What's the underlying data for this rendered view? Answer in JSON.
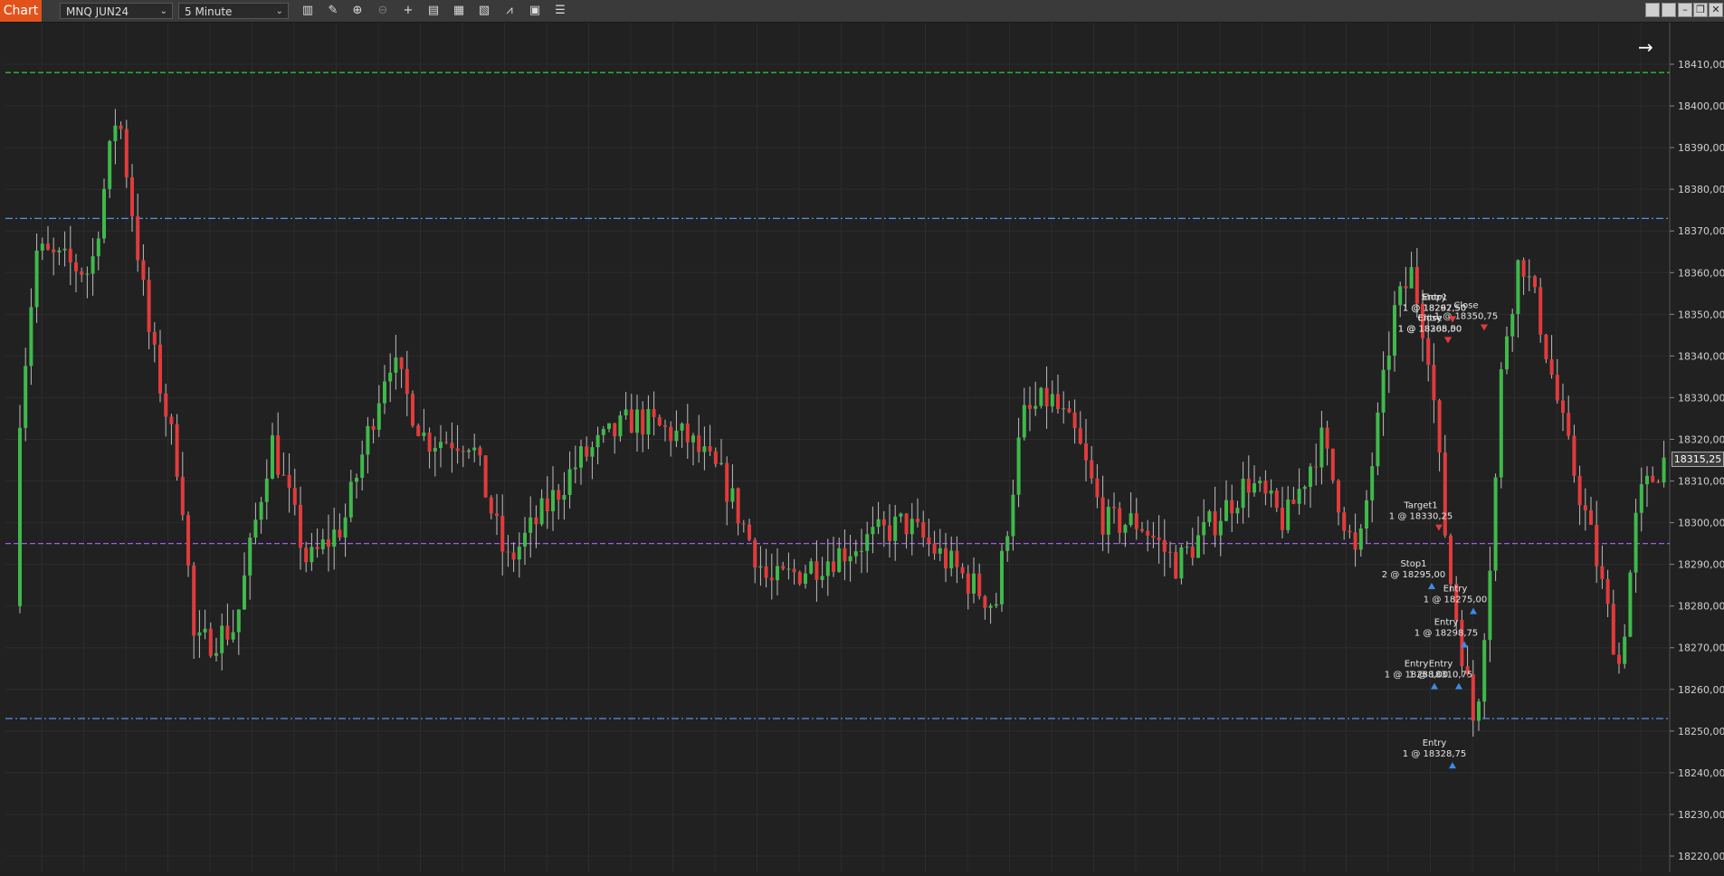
{
  "toolbar": {
    "tab_label": "Chart",
    "instrument": "MNQ JUN24",
    "interval": "5 Minute",
    "tools": [
      "bar-type-icon",
      "pencil-icon",
      "zoom-in-icon",
      "zoom-out-icon",
      "crosshair-icon",
      "properties-icon",
      "templates-icon",
      "indicators-icon",
      "strategies-icon",
      "data-box-icon",
      "list-icon"
    ]
  },
  "axis": {
    "ticks": [
      "18410,00",
      "18400,00",
      "18390,00",
      "18380,00",
      "18370,00",
      "18360,00",
      "18350,00",
      "18340,00",
      "18330,00",
      "18320,00",
      "18310,00",
      "18300,00",
      "18290,00",
      "18280,00",
      "18270,00",
      "18260,00",
      "18250,00",
      "18240,00",
      "18230,00",
      "18220,00"
    ],
    "last_price": "18315,25"
  },
  "colors": {
    "up": "#3fb94a",
    "down": "#e13b3b",
    "green_line": "#2fbf2f",
    "blue_line": "#5b8ee6",
    "purple_line": "#a05af0"
  },
  "chart_data": {
    "type": "candlestick",
    "ylim": [
      18218,
      18418
    ],
    "hlines": [
      {
        "price": 18408,
        "color": "green",
        "style": "dashed"
      },
      {
        "price": 18373,
        "color": "blue",
        "style": "dash-dot"
      },
      {
        "price": 18295,
        "color": "purple",
        "style": "dashed"
      },
      {
        "price": 18253,
        "color": "blue",
        "style": "dash-dot"
      }
    ],
    "annotations": [
      {
        "label": "Stop1",
        "detail": "1 @ 18297,50"
      },
      {
        "label": "Close",
        "detail": "1 @ 18305,00"
      },
      {
        "label": "Close",
        "detail": "1 @ 18350,75"
      },
      {
        "label": "Target1",
        "detail": "1 @ 18330,25"
      },
      {
        "label": "Stop1",
        "detail": "2 @ 18295,00"
      },
      {
        "label": "Entry",
        "detail": "1 @ 18328,75"
      },
      {
        "label": "Entry",
        "detail": "1 @ 18310,75"
      },
      {
        "label": "Entry",
        "detail": "1 @ 18298,75"
      },
      {
        "label": "Entry",
        "detail": "1 @ 18275,00"
      },
      {
        "label": "Entry",
        "detail": "1 @ 18288,00"
      },
      {
        "label": "Entry",
        "detail": "1 @ 18262,50"
      },
      {
        "label": "Entry",
        "detail": "1 @ 18268,50"
      }
    ]
  }
}
